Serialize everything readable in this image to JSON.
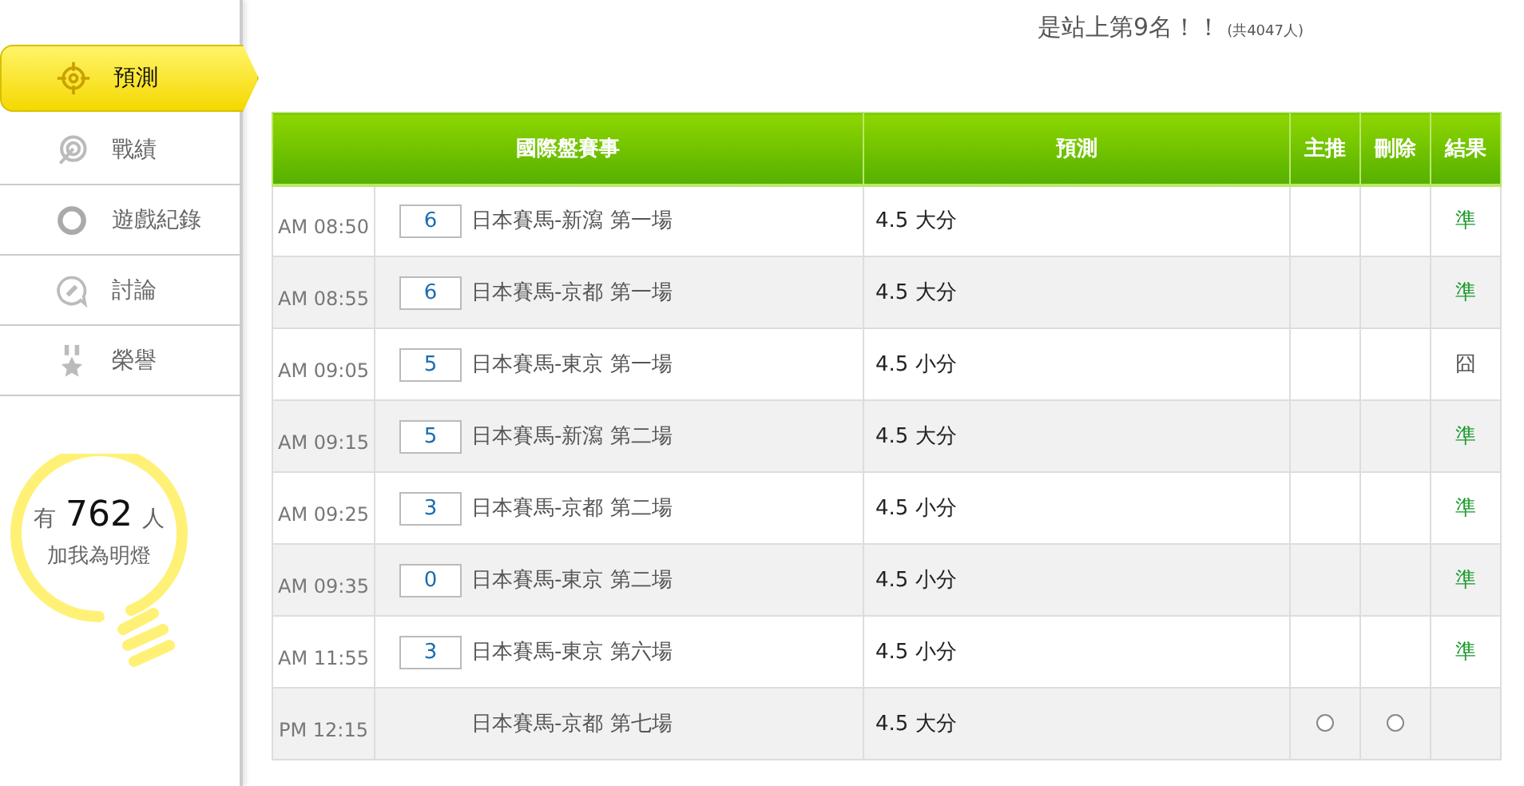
{
  "sidebar": {
    "items": [
      {
        "label": "預測",
        "selected": true
      },
      {
        "label": "戰績",
        "selected": false
      },
      {
        "label": "遊戲紀錄",
        "selected": false
      },
      {
        "label": "討論",
        "selected": false
      },
      {
        "label": "榮譽",
        "selected": false
      }
    ],
    "fans": {
      "prefix": "有",
      "count": "762",
      "suffix": "人",
      "caption": "加我為明燈"
    }
  },
  "rank": {
    "text": "是站上第9名！！",
    "total": "(共4047人)"
  },
  "table": {
    "columns": [
      "國際盤賽事",
      "預測",
      "主推",
      "刪除",
      "結果"
    ],
    "rows": [
      {
        "time": "AM 08:50",
        "count": "6",
        "game": "日本賽馬-新瀉 第一場",
        "prediction": "4.5 大分",
        "result": "準",
        "color": "#1a9a2a"
      },
      {
        "time": "AM 08:55",
        "count": "6",
        "game": "日本賽馬-京都 第一場",
        "prediction": "4.5 大分",
        "result": "準",
        "color": "#1a9a2a"
      },
      {
        "time": "AM 09:05",
        "count": "5",
        "game": "日本賽馬-東京 第一場",
        "prediction": "4.5 小分",
        "result": "囧",
        "color": "#555555"
      },
      {
        "time": "AM 09:15",
        "count": "5",
        "game": "日本賽馬-新瀉 第二場",
        "prediction": "4.5 大分",
        "result": "準",
        "color": "#1a9a2a"
      },
      {
        "time": "AM 09:25",
        "count": "3",
        "game": "日本賽馬-京都 第二場",
        "prediction": "4.5 小分",
        "result": "準",
        "color": "#1a9a2a"
      },
      {
        "time": "AM 09:35",
        "count": "0",
        "game": "日本賽馬-東京 第二場",
        "prediction": "4.5 小分",
        "result": "準",
        "color": "#1a9a2a"
      },
      {
        "time": "AM 11:55",
        "count": "3",
        "game": "日本賽馬-東京 第六場",
        "prediction": "4.5 小分",
        "result": "準",
        "color": "#1a9a2a"
      },
      {
        "time": "PM 12:15",
        "game": "日本賽馬-京都 第七場",
        "prediction": "4.5 大分",
        "main_pick": {
          "selected": false
        },
        "delete": {
          "selected": false
        }
      }
    ]
  }
}
